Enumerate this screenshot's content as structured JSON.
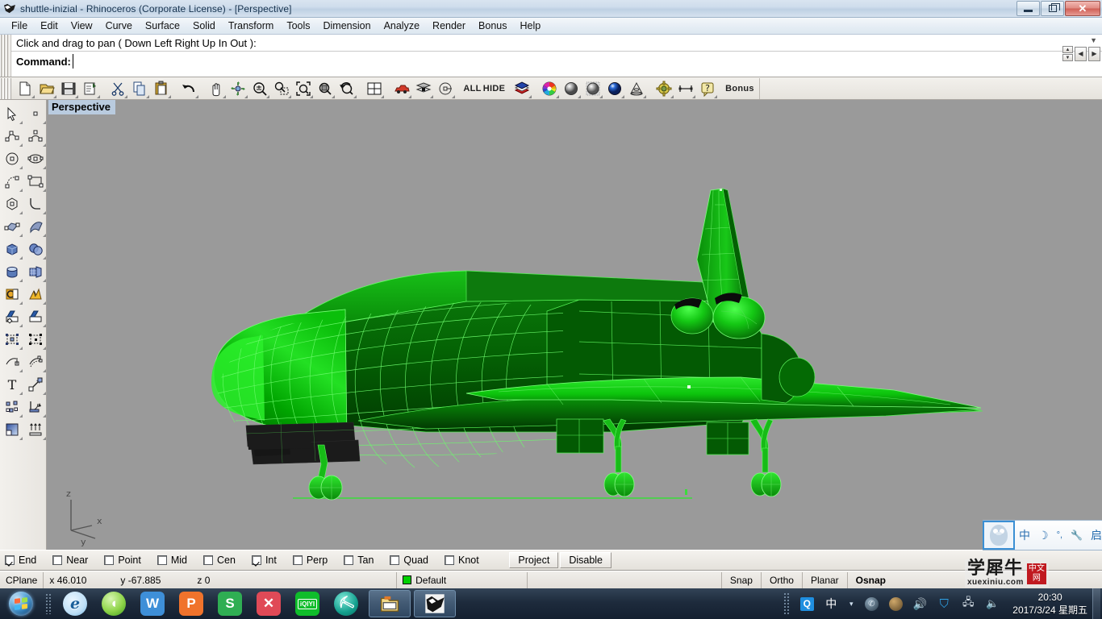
{
  "window": {
    "title": "shuttle-inizial - Rhinoceros (Corporate License) - [Perspective]",
    "app_icon": "rhino-icon",
    "minimize_label": "",
    "maximize_label": "",
    "close_label": "✕"
  },
  "menubar": {
    "items": [
      {
        "label": "File"
      },
      {
        "label": "Edit"
      },
      {
        "label": "View"
      },
      {
        "label": "Curve"
      },
      {
        "label": "Surface"
      },
      {
        "label": "Solid"
      },
      {
        "label": "Transform"
      },
      {
        "label": "Tools"
      },
      {
        "label": "Dimension"
      },
      {
        "label": "Analyze"
      },
      {
        "label": "Render"
      },
      {
        "label": "Bonus"
      },
      {
        "label": "Help"
      }
    ]
  },
  "command_area": {
    "history_line": "Click and drag to pan ( Down  Left  Right  Up  In  Out ):",
    "prompt": "Command:",
    "input_value": "",
    "input_placeholder": ""
  },
  "toolbar": {
    "buttons": [
      {
        "name": "new-file-icon",
        "title": "New"
      },
      {
        "name": "open-file-icon",
        "title": "Open"
      },
      {
        "name": "save-file-icon",
        "title": "Save"
      },
      {
        "name": "print-icon",
        "title": "Print"
      },
      {
        "name": "cut-icon",
        "title": "Cut"
      },
      {
        "name": "copy-icon",
        "title": "Copy"
      },
      {
        "name": "paste-icon",
        "title": "Paste"
      },
      {
        "name": "undo-icon",
        "title": "Undo"
      },
      {
        "name": "pan-hand-icon",
        "title": "Pan"
      },
      {
        "name": "rotate-view-icon",
        "title": "Rotate View"
      },
      {
        "name": "zoom-in-out-icon",
        "title": "Zoom"
      },
      {
        "name": "zoom-window-icon",
        "title": "Zoom Window"
      },
      {
        "name": "zoom-extents-icon",
        "title": "Zoom Extents"
      },
      {
        "name": "zoom-selected-icon",
        "title": "Zoom Selected"
      },
      {
        "name": "zoom-previous-icon",
        "title": "Zoom Previous"
      },
      {
        "name": "four-viewport-icon",
        "title": "4 Viewports"
      },
      {
        "name": "car-render-icon",
        "title": "Render"
      },
      {
        "name": "layers-icon",
        "title": "Layers"
      },
      {
        "name": "select-object-icon",
        "title": "Select"
      },
      {
        "name": "show-all-label",
        "title": "ALL",
        "text": "ALL"
      },
      {
        "name": "hide-objects-label",
        "title": "HIDE",
        "text": "HIDE"
      },
      {
        "name": "surface-stack-icon",
        "title": "Surfaces"
      },
      {
        "name": "color-wheel-icon",
        "title": "Color"
      },
      {
        "name": "shade-sphere-icon",
        "title": "Shade"
      },
      {
        "name": "ghosted-sphere-icon",
        "title": "Ghosted"
      },
      {
        "name": "render-sphere-icon",
        "title": "Rendered"
      },
      {
        "name": "cone-wireframe-icon",
        "title": "Wireframe"
      },
      {
        "name": "gear-render-icon",
        "title": "Properties"
      },
      {
        "name": "dimension-icon",
        "title": "Dimension"
      },
      {
        "name": "help-icon",
        "title": "Help"
      },
      {
        "name": "bonus-label",
        "title": "Bonus",
        "text": "Bonus"
      }
    ]
  },
  "left_toolbar": {
    "buttons": [
      {
        "name": "select-arrow-icon"
      },
      {
        "name": "point-icon"
      },
      {
        "name": "polyline-icon"
      },
      {
        "name": "curve-icon"
      },
      {
        "name": "circle-icon"
      },
      {
        "name": "ellipse-icon"
      },
      {
        "name": "arc-icon"
      },
      {
        "name": "rectangle-icon"
      },
      {
        "name": "polygon-icon"
      },
      {
        "name": "fillet-curve-icon"
      },
      {
        "name": "surface-from-curves-icon"
      },
      {
        "name": "sweep-surface-icon"
      },
      {
        "name": "box-solid-icon"
      },
      {
        "name": "boolean-solid-icon"
      },
      {
        "name": "cylinder-solid-icon"
      },
      {
        "name": "mesh-icon"
      },
      {
        "name": "trim-icon"
      },
      {
        "name": "split-icon"
      },
      {
        "name": "fillet-edge-icon"
      },
      {
        "name": "chamfer-edge-icon"
      },
      {
        "name": "array-icon"
      },
      {
        "name": "transform-icon"
      },
      {
        "name": "offset-curve-icon"
      },
      {
        "name": "offset-surface-icon"
      },
      {
        "name": "text-tool-icon"
      },
      {
        "name": "scale-icon"
      },
      {
        "name": "points-on-icon"
      },
      {
        "name": "revolve-icon"
      },
      {
        "name": "gradient-render-icon"
      },
      {
        "name": "extrude-icon"
      }
    ]
  },
  "viewport": {
    "label": "Perspective",
    "background_color": "#9a9a9a",
    "model_name": "space-shuttle-wireframe-model",
    "model_color": "#00b200",
    "wire_color": "#66ff66",
    "tile_color": "#1a1a1a",
    "ground_line_color": "#33dd33",
    "axis": {
      "z": "z",
      "y": "y",
      "x": "x"
    }
  },
  "osnap": {
    "items": [
      {
        "label": "End",
        "checked": true
      },
      {
        "label": "Near",
        "checked": false
      },
      {
        "label": "Point",
        "checked": false
      },
      {
        "label": "Mid",
        "checked": false
      },
      {
        "label": "Cen",
        "checked": false
      },
      {
        "label": "Int",
        "checked": true
      },
      {
        "label": "Perp",
        "checked": false
      },
      {
        "label": "Tan",
        "checked": false
      },
      {
        "label": "Quad",
        "checked": false
      },
      {
        "label": "Knot",
        "checked": false
      }
    ],
    "project_label": "Project",
    "disable_label": "Disable"
  },
  "statusbar": {
    "cplane_label": "CPlane",
    "x_label": "x 46.010",
    "y_label": "y -67.885",
    "z_label": "z 0",
    "layer_name": "Default",
    "layer_color": "#00d000",
    "toggles": [
      {
        "label": "Snap",
        "active": false
      },
      {
        "label": "Ortho",
        "active": false
      },
      {
        "label": "Planar",
        "active": false
      },
      {
        "label": "Osnap",
        "active": true
      }
    ]
  },
  "taskbar": {
    "start_label": "Start",
    "quick_launch": [
      {
        "name": "internet-explorer-icon",
        "glyph": "e",
        "color": "#8ec7ee"
      },
      {
        "name": "sogou-browser-icon",
        "glyph": "",
        "color": "#5eb830"
      },
      {
        "name": "wps-writer-icon",
        "glyph": "W",
        "color": "#3e8fd8"
      },
      {
        "name": "wps-presentation-icon",
        "glyph": "P",
        "color": "#f0732c"
      },
      {
        "name": "wps-spreadsheet-icon",
        "glyph": "S",
        "color": "#2fae53"
      },
      {
        "name": "kuaibo-icon",
        "glyph": "✕",
        "color": "#e04a57"
      },
      {
        "name": "iqiyi-icon",
        "glyph": "iQIYI",
        "color": "#0fbd2b"
      },
      {
        "name": "pickaxe-app-icon",
        "glyph": "⛏",
        "color": "#13a08e"
      }
    ],
    "open_windows": [
      {
        "name": "file-explorer-window",
        "label": ""
      },
      {
        "name": "rhinoceros-window",
        "label": ""
      }
    ],
    "tray": [
      {
        "name": "qq-tray-icon",
        "glyph": "Q"
      },
      {
        "name": "ime-chinese-icon",
        "glyph": "中"
      },
      {
        "name": "ime-dropdown-icon",
        "glyph": "▾"
      },
      {
        "name": "steam-tray-icon",
        "glyph": ""
      },
      {
        "name": "game-tray-icon",
        "glyph": ""
      },
      {
        "name": "volume-mute-icon",
        "glyph": ""
      },
      {
        "name": "tencent-shield-icon",
        "glyph": ""
      },
      {
        "name": "network-icon",
        "glyph": ""
      },
      {
        "name": "speaker-icon",
        "glyph": ""
      }
    ],
    "clock_time": "20:30",
    "clock_date": "2017/3/24 星期五"
  },
  "ime_bar": {
    "logo": "qq-penguin-icon",
    "items": [
      {
        "name": "ime-mode-chinese",
        "glyph": "中"
      },
      {
        "name": "ime-moon-icon",
        "glyph": "☽"
      },
      {
        "name": "ime-punctuation-icon",
        "glyph": "°,"
      },
      {
        "name": "ime-settings-wrench-icon",
        "glyph": "🔧"
      },
      {
        "name": "ime-toolbox-icon",
        "glyph": "启"
      }
    ]
  },
  "watermark": {
    "title_cn": "学犀牛",
    "url": "xuexiniu.com",
    "badge_line1": "中文",
    "badge_line2": "网"
  }
}
